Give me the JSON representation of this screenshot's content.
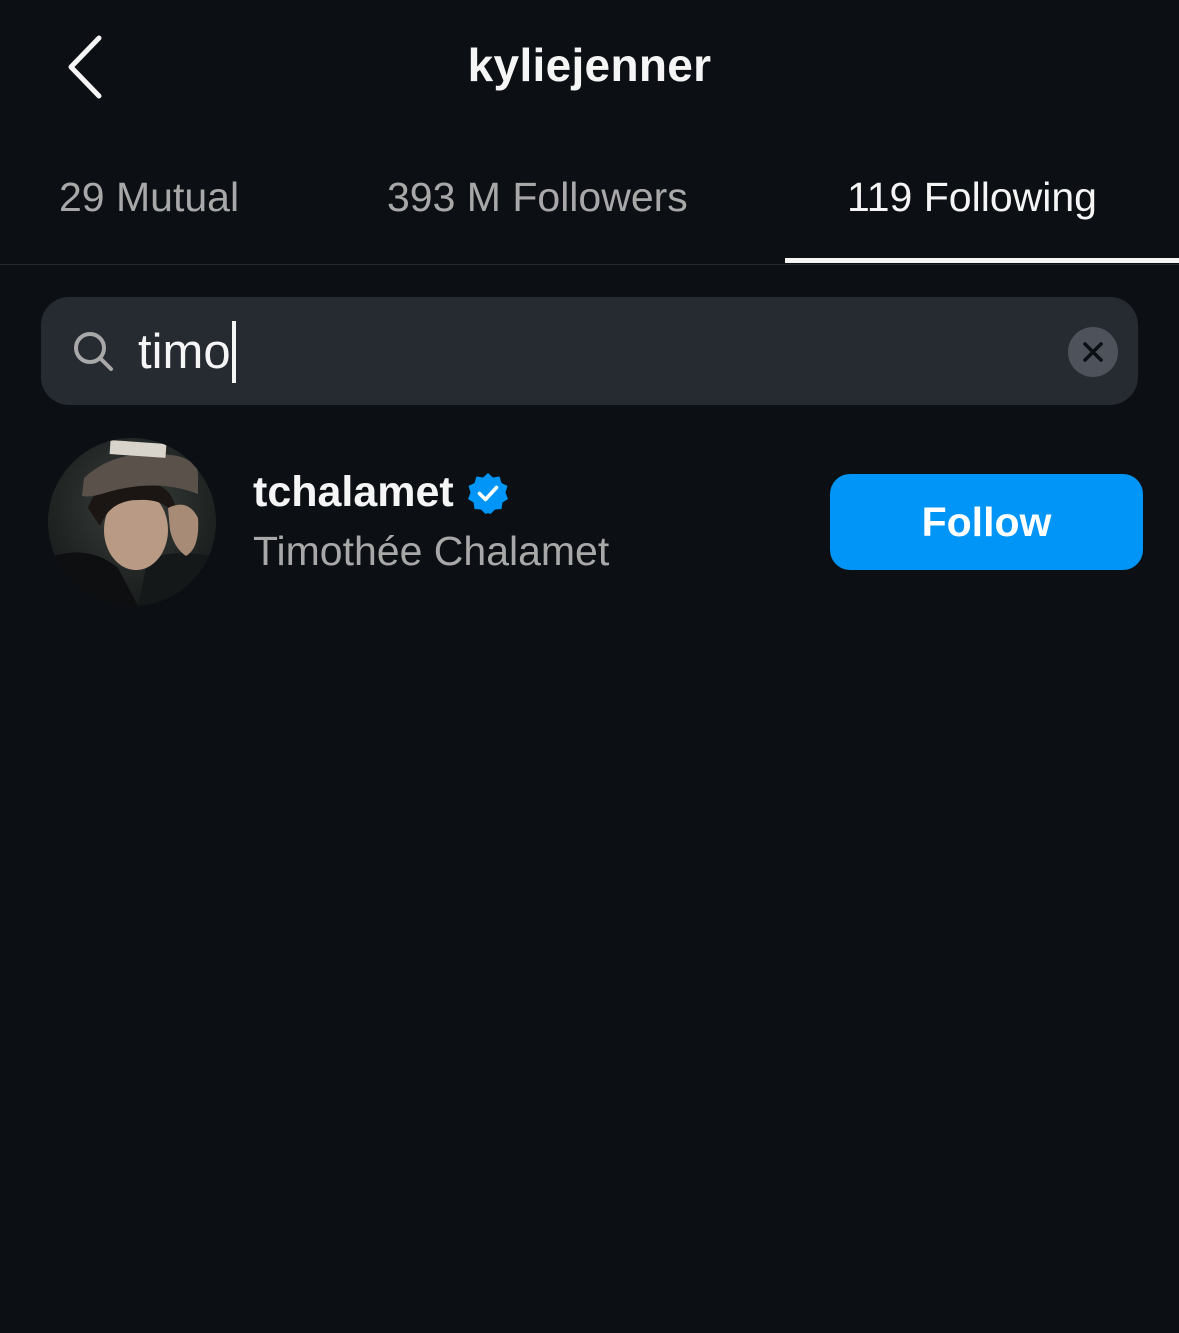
{
  "header": {
    "title": "kyliejenner",
    "back_icon": "chevron-left-icon"
  },
  "tabs": [
    {
      "label": "29 Mutual",
      "active": false
    },
    {
      "label": "393 M Followers",
      "active": false
    },
    {
      "label": "119 Following",
      "active": true
    }
  ],
  "search": {
    "value": "timo",
    "search_icon": "search-icon",
    "clear_icon": "clear-icon"
  },
  "results": [
    {
      "username": "tchalamet",
      "verified": true,
      "full_name": "Timothée Chalamet",
      "button_label": "Follow"
    }
  ],
  "colors": {
    "background": "#0c1014",
    "accent": "#0095f6",
    "verified": "#0095f6",
    "secondary_text": "#a8a8a8",
    "search_bg": "#262a31"
  }
}
